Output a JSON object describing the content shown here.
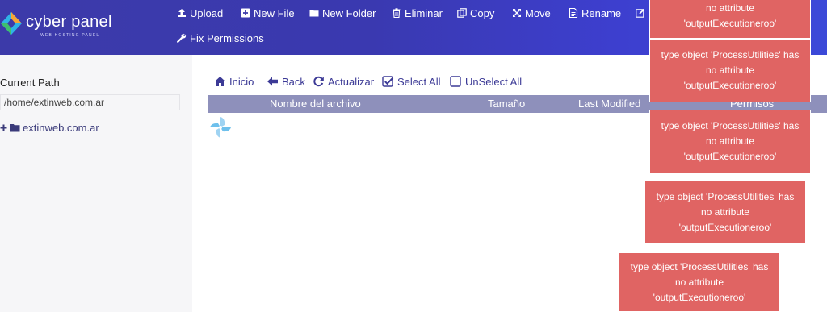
{
  "brand": {
    "name": "cyber panel",
    "tagline": "WEB HOSTING PANEL"
  },
  "toolbar": {
    "upload": "Upload",
    "new_file": "New File",
    "new_folder": "New Folder",
    "delete": "Eliminar",
    "copy": "Copy",
    "move": "Move",
    "rename": "Rename",
    "fix_permissions": "Fix Permissions"
  },
  "sidebar": {
    "current_path_label": "Current Path",
    "current_path_value": "/home/extinweb.com.ar",
    "tree": [
      {
        "label": "extinweb.com.ar"
      }
    ]
  },
  "file_toolbar": {
    "home": "Inicio",
    "back": "Back",
    "refresh": "Actualizar",
    "select_all": "Select All",
    "unselect_all": "UnSelect All"
  },
  "table": {
    "columns": [
      "Nombre del archivo",
      "Tamaño",
      "Last Modified",
      "Permisos"
    ]
  },
  "toasts": [
    {
      "line1": "no attribute",
      "line2": "'outputExecutioneroo'"
    },
    {
      "line1": "type object 'ProcessUtilities' has",
      "line2": "no attribute",
      "line3": "'outputExecutioneroo'"
    },
    {
      "line1": "type object 'ProcessUtilities' has",
      "line2": "no attribute",
      "line3": "'outputExecutioneroo'"
    },
    {
      "line1": "type object 'ProcessUtilities' has",
      "line2": "no attribute",
      "line3": "'outputExecutioneroo'"
    },
    {
      "line1": "type object 'ProcessUtilities' has",
      "line2": "no attribute",
      "line3": "'outputExecutioneroo'"
    }
  ],
  "colors": {
    "header": "#3c3aa9",
    "accent": "#3c3a96",
    "table_header": "#8e90bb",
    "toast": "#e06463"
  }
}
